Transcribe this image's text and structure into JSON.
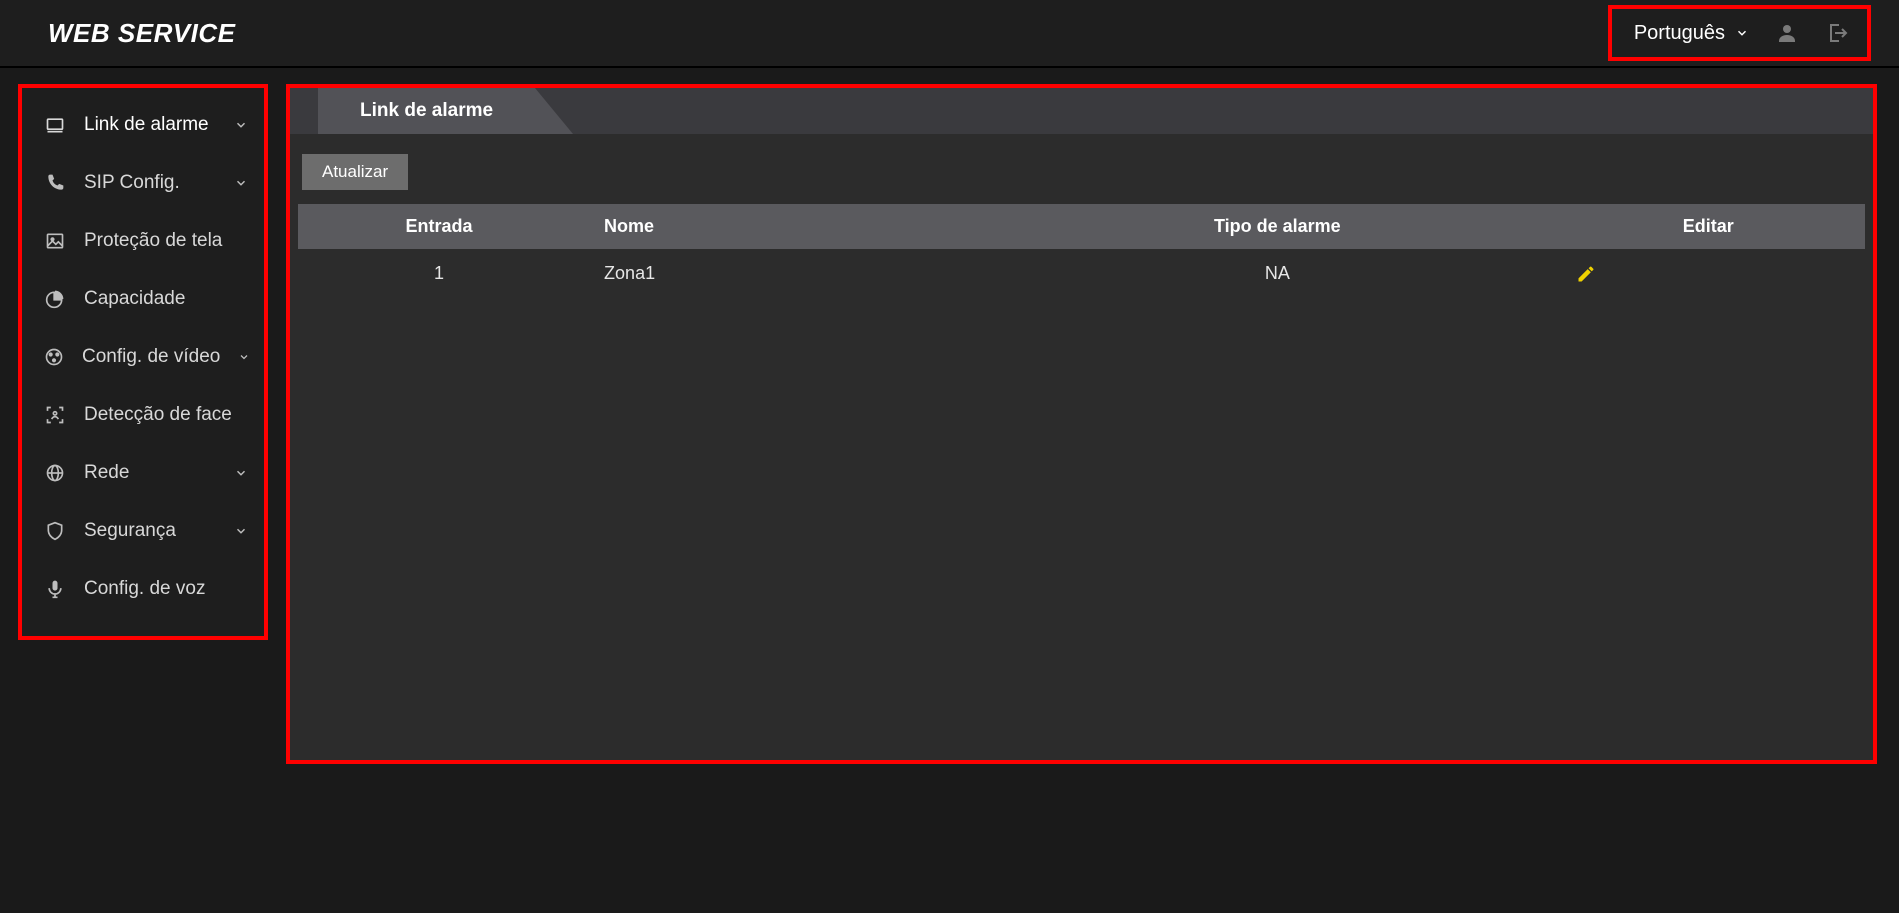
{
  "header": {
    "brand": "WEB SERVICE",
    "language": "Português"
  },
  "sidebar": {
    "items": [
      {
        "label": "Link de alarme",
        "icon": "alarm-link-icon",
        "expandable": true
      },
      {
        "label": "SIP Config.",
        "icon": "phone-icon",
        "expandable": true
      },
      {
        "label": "Proteção de tela",
        "icon": "image-icon",
        "expandable": false
      },
      {
        "label": "Capacidade",
        "icon": "pie-chart-icon",
        "expandable": false
      },
      {
        "label": "Config. de vídeo",
        "icon": "video-icon",
        "expandable": true
      },
      {
        "label": "Detecção de face",
        "icon": "face-detect-icon",
        "expandable": false
      },
      {
        "label": "Rede",
        "icon": "network-icon",
        "expandable": true
      },
      {
        "label": "Segurança",
        "icon": "shield-icon",
        "expandable": true
      },
      {
        "label": "Config. de voz",
        "icon": "mic-icon",
        "expandable": false
      }
    ]
  },
  "main": {
    "tab_title": "Link de alarme",
    "refresh_label": "Atualizar",
    "table": {
      "headers": {
        "input": "Entrada",
        "name": "Nome",
        "type": "Tipo de alarme",
        "edit": "Editar"
      },
      "rows": [
        {
          "input": "1",
          "name": "Zona1",
          "type": "NA"
        }
      ]
    }
  }
}
